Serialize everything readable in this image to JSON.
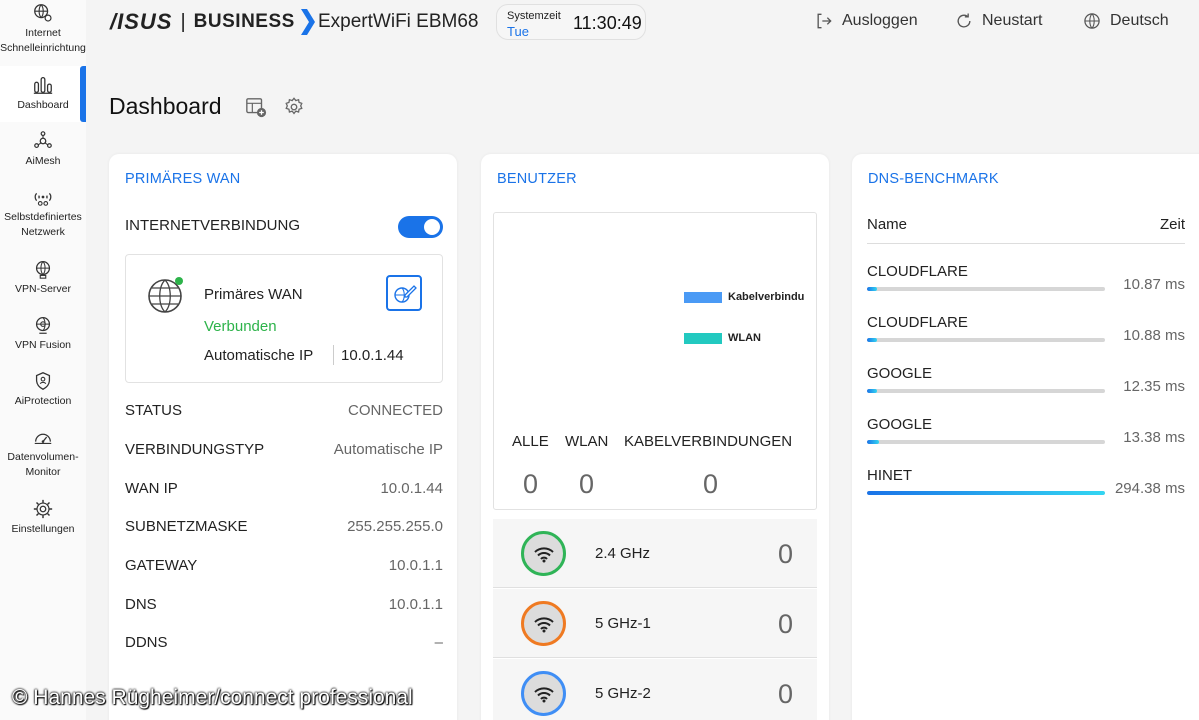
{
  "sidebar": {
    "items": [
      {
        "label": "Internet\nSchnelleinrichtung",
        "icon": "globe-gear-icon"
      },
      {
        "label": "Dashboard",
        "icon": "dashboard-icon",
        "active": true
      },
      {
        "label": "AiMesh",
        "icon": "aimesh-icon"
      },
      {
        "label": "Selbstdefiniertes\nNetzwerk",
        "icon": "custom-network-icon"
      },
      {
        "label": "VPN-Server",
        "icon": "vpn-server-icon"
      },
      {
        "label": "VPN Fusion",
        "icon": "vpn-fusion-icon"
      },
      {
        "label": "AiProtection",
        "icon": "shield-icon"
      },
      {
        "label": "Datenvolumen-\nMonitor",
        "icon": "speedometer-icon"
      },
      {
        "label": "Einstellungen",
        "icon": "gear-icon"
      }
    ]
  },
  "header": {
    "brand_asus": "/ISUS",
    "brand_business": "BUSINESS",
    "model": "ExpertWiFi EBM68",
    "clock_label": "Systemzeit",
    "clock_day": "Tue",
    "clock_time": "11:30:49",
    "logout": "Ausloggen",
    "reboot": "Neustart",
    "language": "Deutsch"
  },
  "page": {
    "title": "Dashboard"
  },
  "wan": {
    "title": "PRIMÄRES WAN",
    "internet_label": "INTERNETVERBINDUNG",
    "internet_enabled": true,
    "box_name": "Primäres WAN",
    "box_state": "Verbunden",
    "box_ip_type": "Automatische IP",
    "box_ip": "10.0.1.44",
    "rows": [
      {
        "key": "STATUS",
        "value": "CONNECTED"
      },
      {
        "key": "VERBINDUNGSTYP",
        "value": "Automatische IP"
      },
      {
        "key": "WAN IP",
        "value": "10.0.1.44"
      },
      {
        "key": "SUBNETZMASKE",
        "value": "255.255.255.0"
      },
      {
        "key": "GATEWAY",
        "value": "10.0.1.1"
      },
      {
        "key": "DNS",
        "value": "10.0.1.1"
      },
      {
        "key": "DDNS",
        "value": "–"
      }
    ]
  },
  "users": {
    "title": "BENUTZER",
    "legend": [
      {
        "label": "Kabelverbindu",
        "color": "#4a9af5"
      },
      {
        "label": "WLAN",
        "color": "#22c9c0"
      }
    ],
    "counts": [
      {
        "label": "ALLE",
        "value": "0"
      },
      {
        "label": "WLAN",
        "value": "0"
      },
      {
        "label": "KABELVERBINDUNGEN",
        "value": "0"
      }
    ],
    "bands": [
      {
        "label": "2.4 GHz",
        "count": "0",
        "color": "#2fb457"
      },
      {
        "label": "5 GHz-1",
        "count": "0",
        "color": "#ef7a22"
      },
      {
        "label": "5 GHz-2",
        "count": "0",
        "color": "#3f8ef5"
      }
    ]
  },
  "dns": {
    "title": "DNS-BENCHMARK",
    "col_name": "Name",
    "col_time": "Zeit",
    "rows": [
      {
        "name": "CLOUDFLARE",
        "time": "10.87 ms",
        "fill": 0.04
      },
      {
        "name": "CLOUDFLARE",
        "time": "10.88 ms",
        "fill": 0.04
      },
      {
        "name": "GOOGLE",
        "time": "12.35 ms",
        "fill": 0.04
      },
      {
        "name": "GOOGLE",
        "time": "13.38 ms",
        "fill": 0.05
      },
      {
        "name": "HINET",
        "time": "294.38 ms",
        "fill": 1.0
      }
    ]
  },
  "watermark": "© Hannes Rügheimer/connect professional",
  "colors": {
    "accent": "#1a73e8",
    "connected": "#2db34a"
  }
}
